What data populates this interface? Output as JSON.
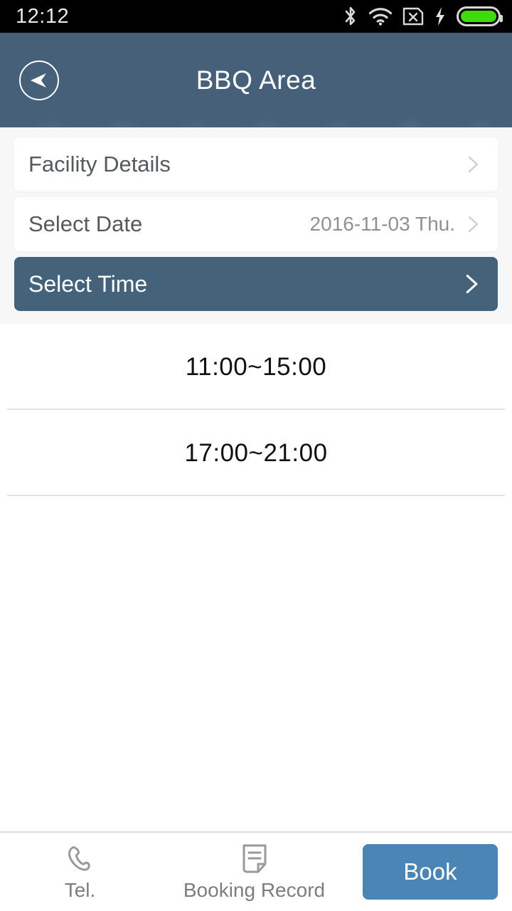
{
  "status_bar": {
    "time": "12:12",
    "icons": [
      "bluetooth-icon",
      "wifi-icon",
      "sim-x-icon",
      "charging-bolt-icon",
      "battery-icon"
    ],
    "battery_color": "#3ddc0a"
  },
  "header": {
    "title": "BBQ Area",
    "back_icon": "back-arrow-icon",
    "background_color": "#46607a"
  },
  "cards": [
    {
      "label": "Facility Details",
      "value": "",
      "active": false,
      "chevron": "chevron-right-icon"
    },
    {
      "label": "Select Date",
      "value": "2016-11-03 Thu.",
      "active": false,
      "chevron": "chevron-right-icon"
    },
    {
      "label": "Select Time",
      "value": "",
      "active": true,
      "chevron": "chevron-right-icon"
    }
  ],
  "time_slots": [
    {
      "label": "11:00~15:00"
    },
    {
      "label": "17:00~21:00"
    }
  ],
  "bottom_bar": {
    "tel": {
      "label": "Tel.",
      "icon": "phone-icon"
    },
    "booking_record": {
      "label": "Booking Record",
      "icon": "document-icon"
    },
    "book_button": {
      "label": "Book",
      "color": "#4a85b5"
    }
  }
}
